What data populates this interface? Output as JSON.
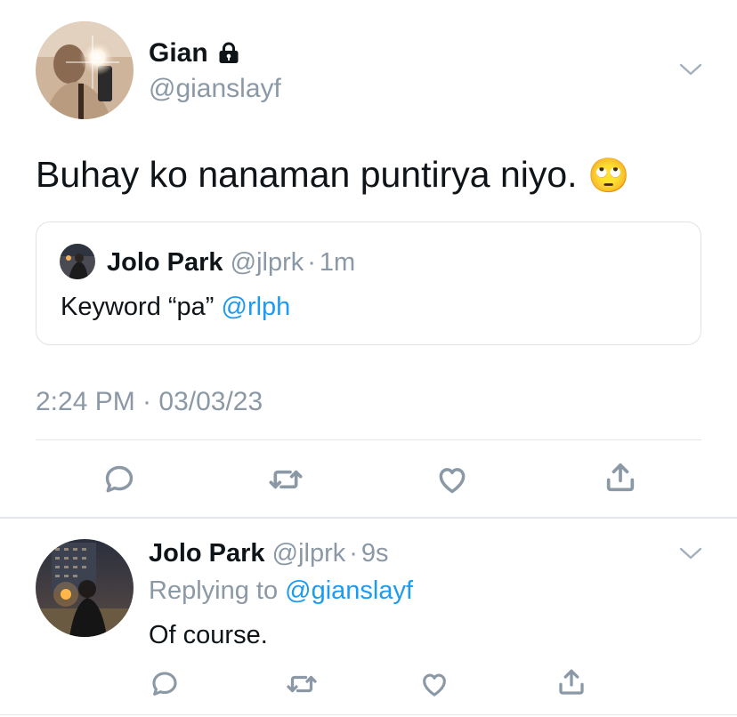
{
  "main_tweet": {
    "author": {
      "name": "Gian",
      "handle": "@gianslayf",
      "locked": true
    },
    "text": "Buhay ko nanaman puntirya niyo.",
    "emoji": "🙄",
    "quote": {
      "name": "Jolo Park",
      "handle": "@jlprk",
      "separator": "·",
      "time": "1m",
      "text_prefix": "Keyword “pa” ",
      "mention": "@rlph"
    },
    "timestamp": "2:24 PM · 03/03/23",
    "actions": [
      "reply-icon",
      "retweet-icon",
      "like-icon",
      "share-icon"
    ]
  },
  "reply_tweet": {
    "author": {
      "name": "Jolo Park",
      "handle": "@jlprk"
    },
    "separator": "·",
    "time": "9s",
    "replying_label": "Replying to ",
    "replying_to": "@gianslayf",
    "text": "Of course.",
    "actions": [
      "reply-icon",
      "retweet-icon",
      "like-icon",
      "share-icon"
    ]
  },
  "colors": {
    "link": "#1d9bf0",
    "muted": "#8b98a5",
    "text": "#0f1419",
    "divider": "#e3e6ea"
  }
}
